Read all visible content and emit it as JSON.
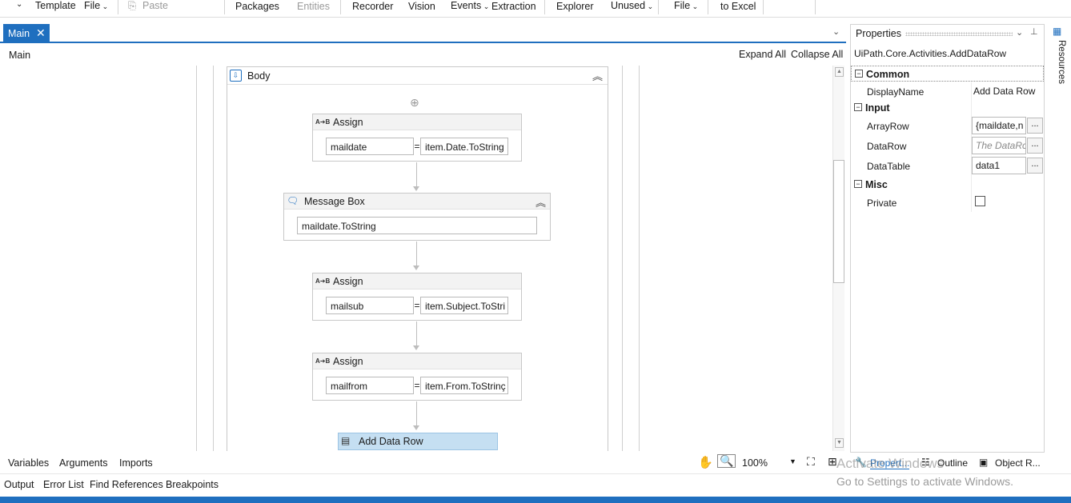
{
  "ribbon": {
    "items": [
      "Template",
      "File",
      "Paste",
      "Packages",
      "Entities",
      "Recorder",
      "Vision",
      "Events",
      "Extraction",
      "Explorer",
      "Unused",
      "File",
      "to Excel"
    ]
  },
  "doc_tab": {
    "label": "Main"
  },
  "breadcrumb": {
    "label": "Main",
    "expand_all": "Expand All",
    "collapse_all": "Collapse All"
  },
  "sequence": {
    "title": "Body"
  },
  "activities": [
    {
      "type": "Assign",
      "to": "maildate",
      "value": "item.Date.ToString"
    },
    {
      "type": "Message Box",
      "text": "maildate.ToString"
    },
    {
      "type": "Assign",
      "to": "mailsub",
      "value": "item.Subject.ToStri"
    },
    {
      "type": "Assign",
      "to": "mailfrom",
      "value": "item.From.ToStrinç"
    },
    {
      "type": "Add Data Row"
    }
  ],
  "assign_icon_text": "A➔B",
  "equals": "=",
  "properties": {
    "title": "Properties",
    "type_name": "UiPath.Core.Activities.AddDataRow",
    "categories": {
      "common": "Common",
      "input": "Input",
      "misc": "Misc"
    },
    "rows": {
      "display_name": {
        "label": "DisplayName",
        "value": "Add Data Row"
      },
      "array_row": {
        "label": "ArrayRow",
        "value": "{maildate,n"
      },
      "data_row": {
        "label": "DataRow",
        "placeholder": "The DataRc"
      },
      "data_table": {
        "label": "DataTable",
        "value": "data1"
      },
      "private": {
        "label": "Private",
        "checked": false
      }
    },
    "ellipsis": "..."
  },
  "resources_label": "Resources",
  "bottom": {
    "tabs": [
      "Variables",
      "Arguments",
      "Imports"
    ],
    "zoom": "100%",
    "panel_tabs": [
      "Propert...",
      "Outline",
      "Object R..."
    ],
    "output_tabs": [
      "Output",
      "Error List",
      "Find References",
      "Breakpoints"
    ]
  },
  "watermark": {
    "line1": "Activate Windows",
    "line2": "Go to Settings to activate Windows."
  },
  "colors": {
    "accent": "#1f6fbf",
    "selected": "#c5dff2"
  }
}
